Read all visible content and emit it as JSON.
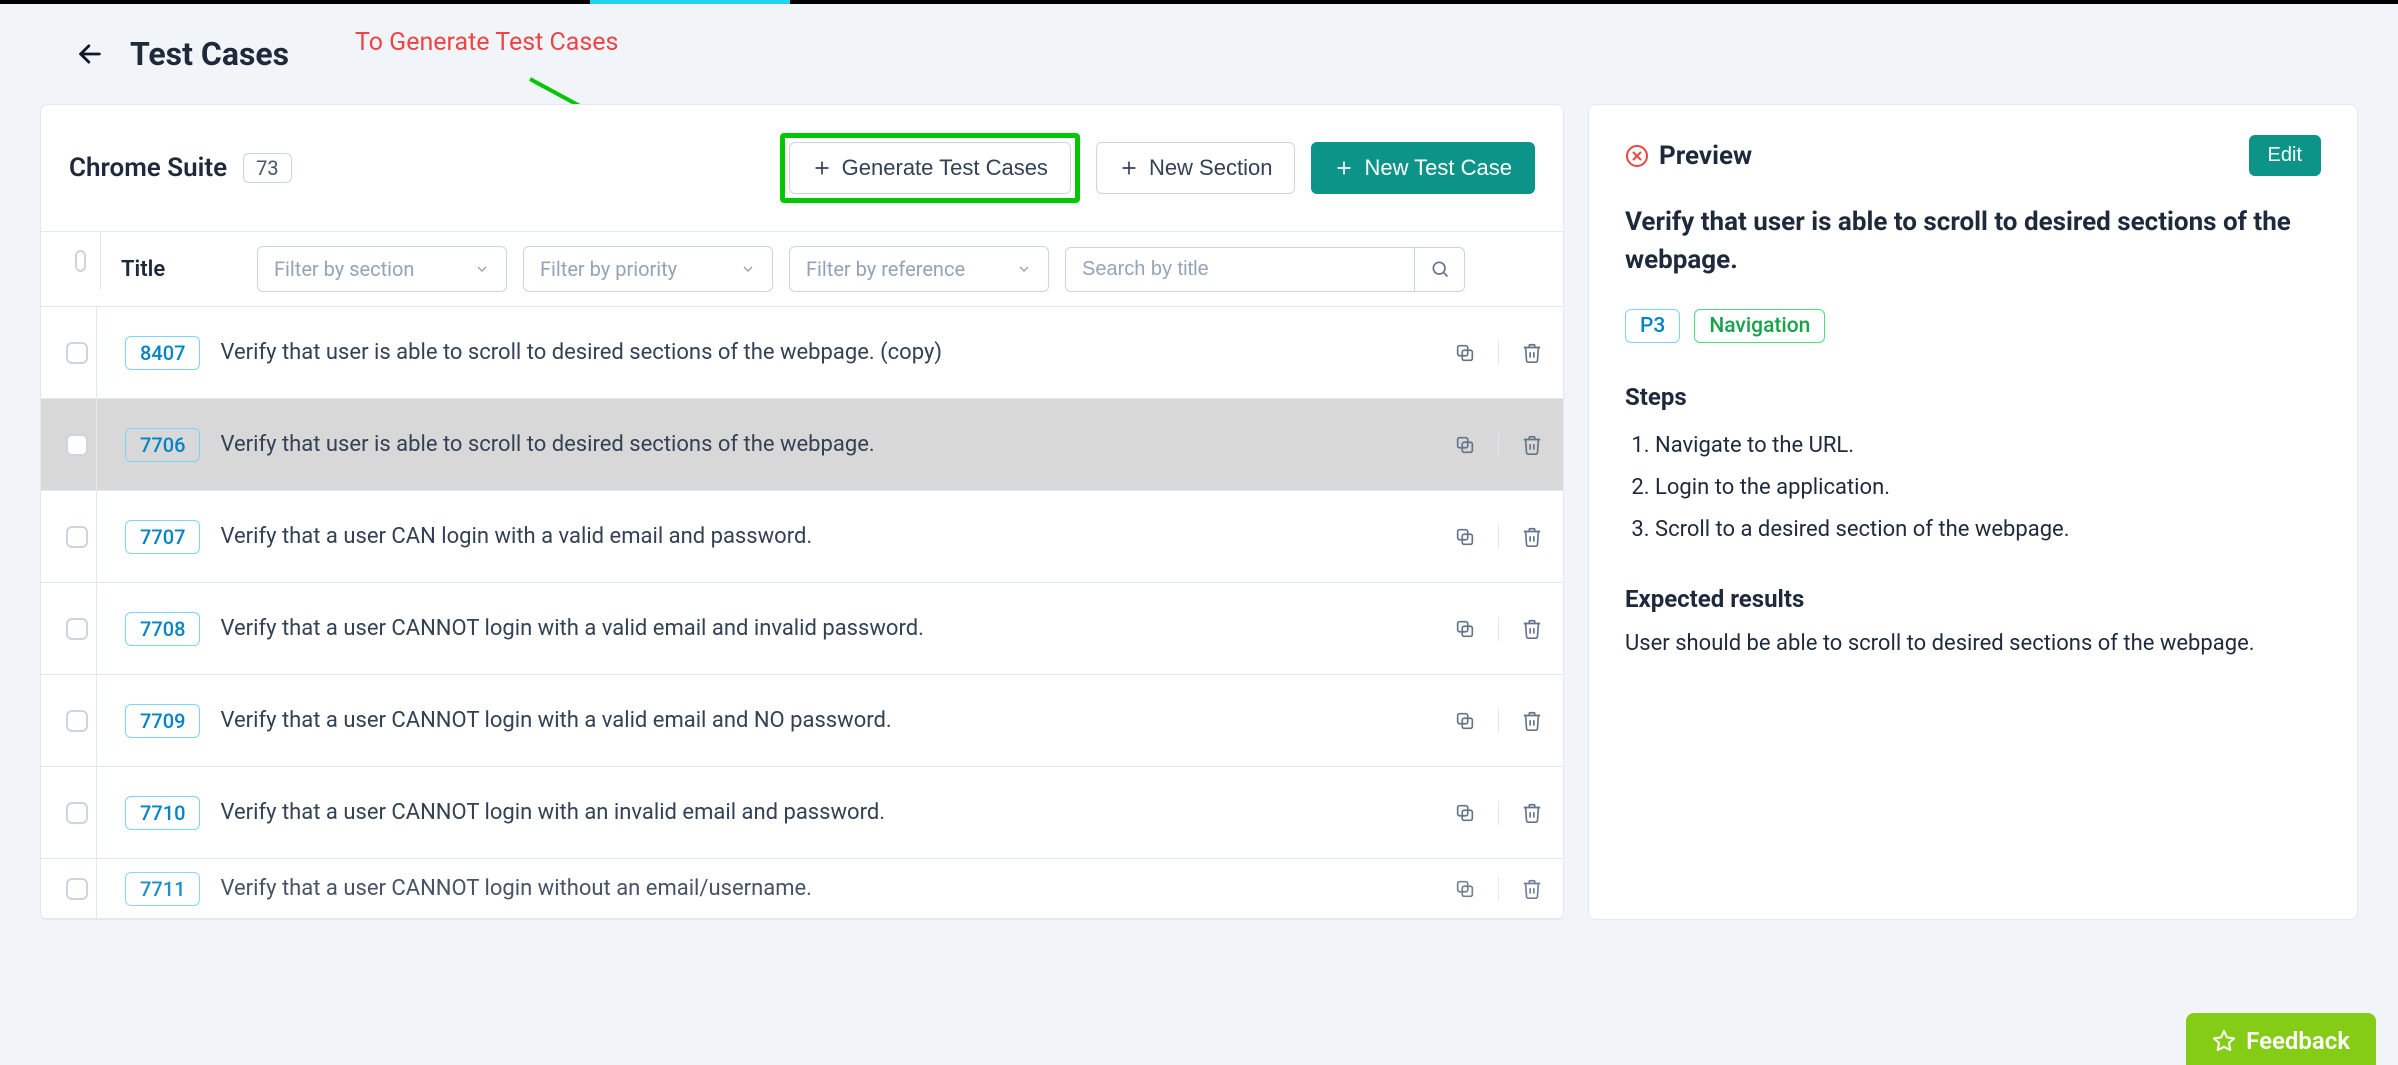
{
  "header": {
    "title": "Test Cases",
    "annotation": "To Generate Test Cases"
  },
  "toolbar": {
    "suite_name": "Chrome Suite",
    "suite_count": "73",
    "generate_label": "Generate Test Cases",
    "new_section_label": "New Section",
    "new_test_case_label": "New Test Case"
  },
  "filters": {
    "title_header": "Title",
    "section_placeholder": "Filter by section",
    "priority_placeholder": "Filter by priority",
    "reference_placeholder": "Filter by reference",
    "search_placeholder": "Search by title"
  },
  "rows": [
    {
      "id": "8407",
      "title": "Verify that user is able to scroll to desired sections of the webpage. (copy)",
      "selected": false
    },
    {
      "id": "7706",
      "title": "Verify that user is able to scroll to desired sections of the webpage.",
      "selected": true
    },
    {
      "id": "7707",
      "title": "Verify that a user CAN login with a valid email and password.",
      "selected": false
    },
    {
      "id": "7708",
      "title": "Verify that a user CANNOT login with a valid email and invalid password.",
      "selected": false
    },
    {
      "id": "7709",
      "title": "Verify that a user CANNOT login with a valid email and NO password.",
      "selected": false
    },
    {
      "id": "7710",
      "title": "Verify that a user CANNOT login with an invalid email and password.",
      "selected": false
    },
    {
      "id": "7711",
      "title": "Verify that a user CANNOT login without an email/username.",
      "selected": false,
      "partial": true
    }
  ],
  "preview": {
    "heading": "Preview",
    "edit_label": "Edit",
    "title": "Verify that user is able to scroll to desired sections of the webpage.",
    "priority_tag": "P3",
    "category_tag": "Navigation",
    "steps_heading": "Steps",
    "steps": [
      "Navigate to the URL.",
      "Login to the application.",
      "Scroll to a desired section of the webpage."
    ],
    "expected_heading": "Expected results",
    "expected": "User should be able to scroll to desired sections of the webpage."
  },
  "feedback_label": "Feedback"
}
